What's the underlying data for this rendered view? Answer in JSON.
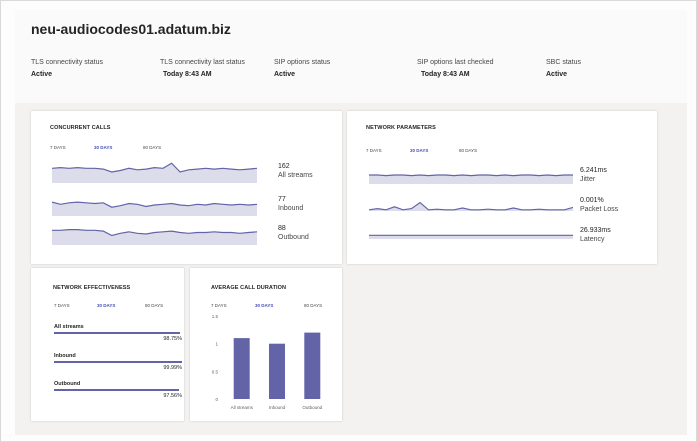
{
  "header": {
    "hostname": "neu-audiocodes01.adatum.biz",
    "statuses": [
      {
        "label": "TLS connectivity status",
        "value": "Active"
      },
      {
        "label": "TLS connectivity last status",
        "value": "Today 8:43 AM"
      },
      {
        "label": "SIP options status",
        "value": "Active"
      },
      {
        "label": "SIP options last checked",
        "value": "Today 8:43 AM"
      },
      {
        "label": "SBC status",
        "value": "Active"
      }
    ]
  },
  "tabs": [
    "7 DAYS",
    "30 DAYS",
    "80 DAYS"
  ],
  "active_tab": "30 DAYS",
  "concurrent_calls": {
    "title": "CONCURRENT CALLS",
    "metrics": [
      {
        "value": "162",
        "label": "All streams",
        "series": [
          20,
          21,
          20,
          21,
          20,
          20,
          19,
          15,
          17,
          20,
          18,
          19,
          21,
          20,
          27,
          15,
          18,
          19,
          20,
          19,
          20,
          19,
          18,
          19,
          20
        ]
      },
      {
        "value": "77",
        "label": "Inbound",
        "series": [
          19,
          16,
          18,
          19,
          18,
          17,
          18,
          12,
          14,
          17,
          16,
          13,
          15,
          16,
          17,
          15,
          14,
          16,
          15,
          17,
          16,
          15,
          16,
          15,
          16
        ]
      },
      {
        "value": "88",
        "label": "Outbound",
        "series": [
          20,
          20,
          21,
          21,
          20,
          20,
          19,
          13,
          16,
          18,
          16,
          15,
          17,
          18,
          19,
          17,
          16,
          17,
          17,
          18,
          17,
          17,
          16,
          17,
          18
        ]
      }
    ]
  },
  "network_parameters": {
    "title": "NETWORK PARAMETERS",
    "metrics": [
      {
        "value": "6.241ms",
        "label": "Jitter",
        "series": [
          15,
          15,
          14,
          15,
          15,
          14,
          15,
          14,
          15,
          15,
          14,
          15,
          14,
          15,
          15,
          14,
          15,
          14,
          15,
          15,
          14,
          15,
          14,
          15,
          15
        ]
      },
      {
        "value": "0.001%",
        "label": "Packet Loss",
        "series": [
          2,
          4,
          2,
          7,
          2,
          4,
          14,
          2,
          3,
          2,
          2,
          5,
          2,
          2,
          3,
          2,
          2,
          5,
          2,
          2,
          3,
          2,
          2,
          2,
          6
        ]
      },
      {
        "value": "26.933ms",
        "label": "Latency",
        "series": [
          8,
          8,
          8,
          8,
          8,
          8,
          8,
          8,
          8,
          8,
          8,
          8,
          8,
          8,
          8,
          8,
          8,
          8,
          8,
          8,
          8,
          8,
          8,
          8,
          8
        ]
      }
    ]
  },
  "network_effectiveness": {
    "title": "NETWORK EFFECTIVENESS",
    "rows": [
      {
        "name": "All streams",
        "value": "98.75%",
        "fraction": 0.9875
      },
      {
        "name": "Inbound",
        "value": "99.99%",
        "fraction": 0.9999
      },
      {
        "name": "Outbound",
        "value": "97.56%",
        "fraction": 0.9756
      }
    ]
  },
  "average_call_duration": {
    "title": "AVERAGE CALL DURATION",
    "chart_data": {
      "type": "bar",
      "categories": [
        "All streams",
        "Inbound",
        "Outbound"
      ],
      "values": [
        1.1,
        1.0,
        1.2
      ],
      "yticks": [
        0,
        0.5,
        1,
        1.5
      ],
      "ylim": [
        0,
        1.5
      ],
      "color": "#6264a7"
    }
  },
  "colors": {
    "accent": "#6264a7",
    "area_fill": "#dcdcea",
    "active_tab": "#464eb8"
  }
}
